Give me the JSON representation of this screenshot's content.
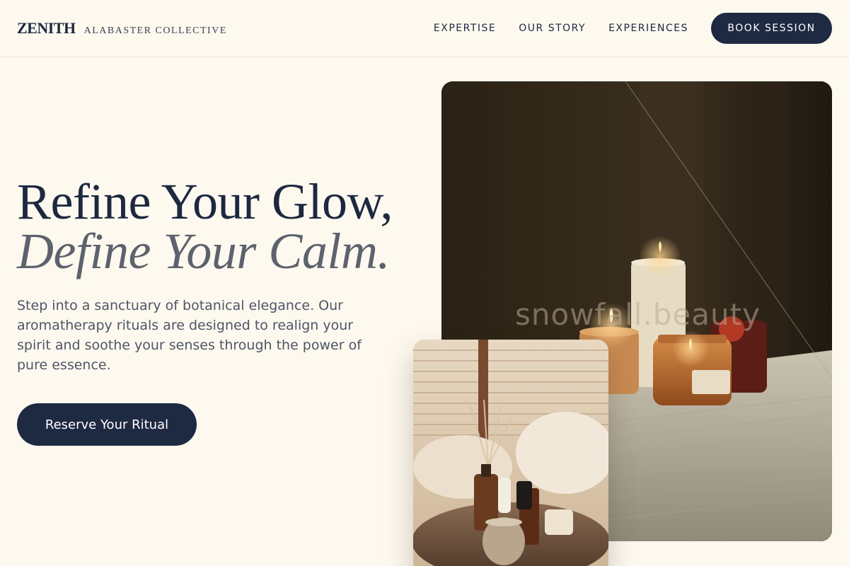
{
  "brand": {
    "name": "ZENITH",
    "subtitle": "ALABASTER COLLECTIVE"
  },
  "nav": {
    "links": [
      "EXPERTISE",
      "OUR STORY",
      "EXPERIENCES"
    ],
    "cta_label": "BOOK SESSION"
  },
  "hero": {
    "title_line1": "Refine Your Glow,",
    "title_line2": "Define Your Calm.",
    "description": "Step into a sanctuary of botanical elegance. Our aromatherapy rituals are designed to realign your spirit and soothe your senses through the power of pure essence.",
    "cta_label": "Reserve Your Ritual"
  },
  "images": {
    "main_watermark": "snowfall.beauty"
  },
  "colors": {
    "background": "#fdf9ef",
    "navy": "#1e2942",
    "muted_text": "#4f5567"
  }
}
